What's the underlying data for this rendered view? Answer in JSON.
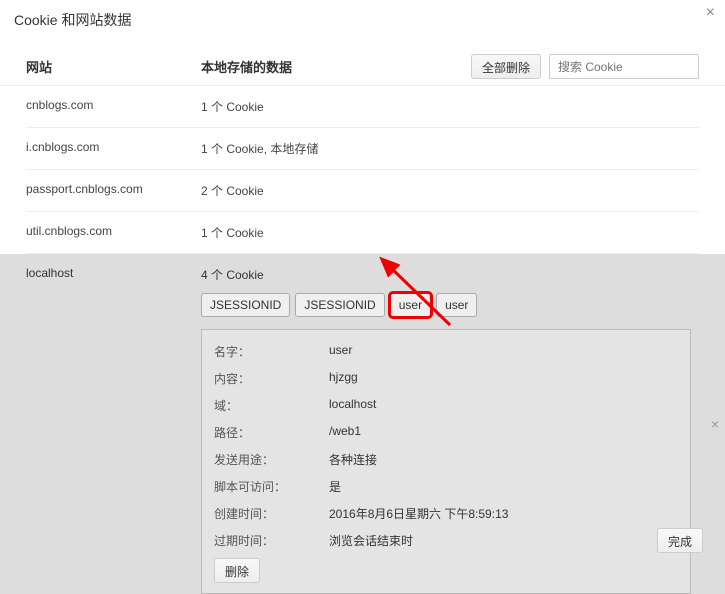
{
  "title": "Cookie 和网站数据",
  "headers": {
    "site": "网站",
    "data": "本地存储的数据"
  },
  "buttons": {
    "delete_all": "全部删除",
    "done": "完成",
    "delete": "删除"
  },
  "search": {
    "placeholder": "搜索 Cookie"
  },
  "sites": [
    {
      "name": "cnblogs.com",
      "data": "1 个 Cookie"
    },
    {
      "name": "i.cnblogs.com",
      "data": "1 个 Cookie, 本地存储"
    },
    {
      "name": "passport.cnblogs.com",
      "data": "2 个 Cookie"
    },
    {
      "name": "util.cnblogs.com",
      "data": "1 个 Cookie"
    }
  ],
  "expanded": {
    "name": "localhost",
    "data": "4 个 Cookie",
    "tabs": [
      "JSESSIONID",
      "JSESSIONID",
      "user",
      "user"
    ],
    "highlighted_index": 2,
    "details": [
      {
        "label": "名字：",
        "value": "user"
      },
      {
        "label": "内容：",
        "value": "hjzgg"
      },
      {
        "label": "域：",
        "value": "localhost"
      },
      {
        "label": "路径：",
        "value": "/web1"
      },
      {
        "label": "发送用途：",
        "value": "各种连接"
      },
      {
        "label": "脚本可访问：",
        "value": "是"
      },
      {
        "label": "创建时间：",
        "value": "2016年8月6日星期六 下午8:59:13"
      },
      {
        "label": "过期时间：",
        "value": "浏览会话结束时"
      }
    ]
  }
}
